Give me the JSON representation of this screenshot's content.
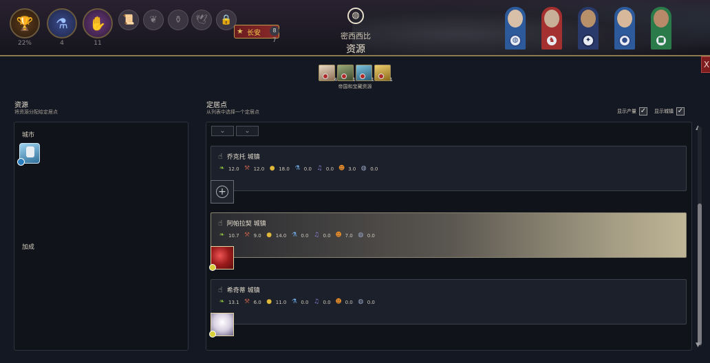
{
  "topbar": {
    "stats": [
      {
        "name": "trophy",
        "value": "22%",
        "color": "#8b5a1e"
      },
      {
        "name": "science",
        "value": "4",
        "color": "#4f5fa0"
      },
      {
        "name": "influence",
        "value": "11",
        "color": "#7a4b8c"
      }
    ],
    "city_banner": {
      "label": "长安",
      "pop": "8",
      "num": "7"
    },
    "subtitle": "密西西比",
    "title": "资源"
  },
  "empire": {
    "resources": [
      {
        "count": "4",
        "color": "#c8b5a0"
      },
      {
        "count": "1",
        "color": "#6d7c5a"
      },
      {
        "count": "1",
        "color": "#4b8aa8"
      },
      {
        "count": "1",
        "color": "#c9a03a"
      }
    ],
    "caption": "帝国和宝藏资源"
  },
  "left": {
    "title": "资源",
    "subtitle": "将资源分配给定居点",
    "city_label": "城市",
    "bonus_label": "加成"
  },
  "right": {
    "title": "定居点",
    "subtitle": "从列表中选择一个定居点",
    "show_yields_label": "显示产量",
    "show_towns_label": "显示城镇",
    "show_yields_checked": "✓",
    "show_towns_checked": "✓"
  },
  "settlements": [
    {
      "name": "乔克托 城镇",
      "yields": [
        "12.0",
        "12.0",
        "18.0",
        "0.0",
        "0.0",
        "3.0",
        "0.0"
      ]
    },
    {
      "name": "阿帕拉契 城镇",
      "yields": [
        "10.7",
        "9.0",
        "14.0",
        "0.0",
        "0.0",
        "7.0",
        "0.0"
      ]
    },
    {
      "name": "希奇蒂 城镇",
      "yields": [
        "13.1",
        "6.0",
        "11.0",
        "0.0",
        "0.0",
        "0.0",
        "0.0"
      ]
    }
  ],
  "yield_icons": [
    {
      "name": "food-icon",
      "glyph": "❧",
      "color": "#8cbf3f"
    },
    {
      "name": "production-icon",
      "glyph": "⚒",
      "color": "#b55a4a"
    },
    {
      "name": "gold-icon",
      "glyph": "●",
      "color": "#e0b83a"
    },
    {
      "name": "science-icon",
      "glyph": "⚗",
      "color": "#6ea6e0"
    },
    {
      "name": "culture-icon",
      "glyph": "♫",
      "color": "#8b7fd6"
    },
    {
      "name": "happiness-icon",
      "glyph": "☻",
      "color": "#e28a2a"
    },
    {
      "name": "influence-icon",
      "glyph": "◍",
      "color": "#9aa9c8"
    }
  ],
  "close_label": "X"
}
